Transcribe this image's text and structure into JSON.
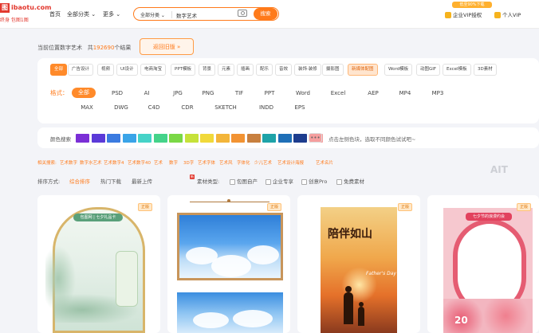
{
  "topbar": {
    "logo_mark": "图",
    "logo_text": "ibaotu.com",
    "logo_sub": "终身 包图1图",
    "nav": [
      "首页",
      "全部分类 ⌄",
      "更多 ⌄"
    ],
    "search": {
      "category": "全部分类 ⌄",
      "value": "数字艺术",
      "button": "搜索"
    },
    "promo": "低至90%下载",
    "vip_enterprise": "企业VIP授权",
    "vip_personal": "个人VIP"
  },
  "breadcrumb": {
    "prefix": "当前位置数字艺术",
    "count_prefix": "共",
    "count": "192690",
    "count_suffix": "个结果",
    "back_button": "返回旧版 »"
  },
  "categories": [
    "全部",
    "广告设计",
    "视频",
    "UI设计",
    "电商淘宝",
    "PPT模板",
    "背景",
    "元素",
    "插画",
    "配乐",
    "音效",
    "装饰·装修",
    "摄影图",
    "新媒体配图",
    "Word模板",
    "动图GIF",
    "Excel模板",
    "3D素材"
  ],
  "formats": {
    "label": "格式：",
    "row1": [
      "全部",
      "PSD",
      "AI",
      "JPG",
      "PNG",
      "TIF",
      "PPT",
      "Word",
      "Excel",
      "AEP",
      "MP4",
      "MP3"
    ],
    "row2": [
      "MAX",
      "DWG",
      "C4D",
      "CDR",
      "SKETCH",
      "INDD",
      "EPS"
    ]
  },
  "colors": {
    "label": "颜色搜索",
    "swatches": [
      "#7b2fd6",
      "#5b3ad8",
      "#3b7be0",
      "#3aa4e8",
      "#46d3c8",
      "#44d38a",
      "#7ad846",
      "#c6e23a",
      "#f1d93a",
      "#f3b53a",
      "#f29333",
      "#c8803f",
      "#1ea3a8",
      "#1f6fb7",
      "#1d3d8e",
      "#f59e9e"
    ],
    "more": "•••",
    "hint": "点击左侧色块，选取不同颜色试试吧~"
  },
  "related": [
    "相关搜索:",
    "艺术数字",
    "数字水艺术",
    "艺术数字4",
    "艺术数字40",
    "艺术",
    "数字",
    "3D字",
    "艺术字体",
    "艺术风",
    "字体化",
    "少儿艺术",
    "艺术设计海报",
    "艺术名片"
  ],
  "sort": {
    "label": "排序方式:",
    "options": [
      "综合排序",
      "热门下载",
      "最新上传"
    ],
    "new_badge": "新",
    "material_label": "素材类型:",
    "material_options": [
      "包图自产",
      "企业专享",
      "创意Pro",
      "免费素材"
    ]
  },
  "watermark": "AIT",
  "cards": [
    {
      "badge": "正版",
      "pill": "包图网 | 七夕礼品卡"
    },
    {
      "badge": "正版"
    },
    {
      "badge": "正版",
      "title": "陪伴如山",
      "subtitle": "Father's Day"
    },
    {
      "badge": "正版",
      "head": "七夕节的浪漫约会",
      "number": "20"
    }
  ]
}
